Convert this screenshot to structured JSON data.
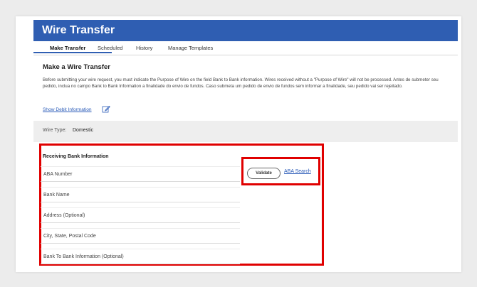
{
  "header": {
    "title": "Wire Transfer"
  },
  "tabs": [
    {
      "label": "Make Transfer"
    },
    {
      "label": "Scheduled"
    },
    {
      "label": "History"
    },
    {
      "label": "Manage Templates"
    }
  ],
  "main": {
    "section_title": "Make a Wire Transfer",
    "notice": "Before submitting your wire request, you must indicate the Purpose of Wire on the field Bank to Bank information. Wires received without a \"Purpose of Wire\" will not be processed. Antes de submeter seu pedido, inclua no campo Bank to Bank Information a finalidade do envio de fundos. Caso submeta um pedido de envio de fundos sem informar a finalidade, seu pedido vai ser rejeitado.",
    "debit_link": "Show Debit Information",
    "wire_type_label": "Wire Type:",
    "wire_type_value": "Domestic"
  },
  "receiving": {
    "title": "Receiving Bank Information",
    "fields": [
      {
        "label": "ABA Number"
      },
      {
        "label": "Bank Name"
      },
      {
        "label": "Address (Optional)"
      },
      {
        "label": "City, State, Postal Code"
      },
      {
        "label": "Bank To Bank Information (Optional)"
      }
    ],
    "validate_label": "Validate",
    "aba_search_label": "ABA Search"
  },
  "colors": {
    "brand": "#2f5eb2",
    "highlight": "#e00000",
    "link": "#2a5bb8"
  }
}
